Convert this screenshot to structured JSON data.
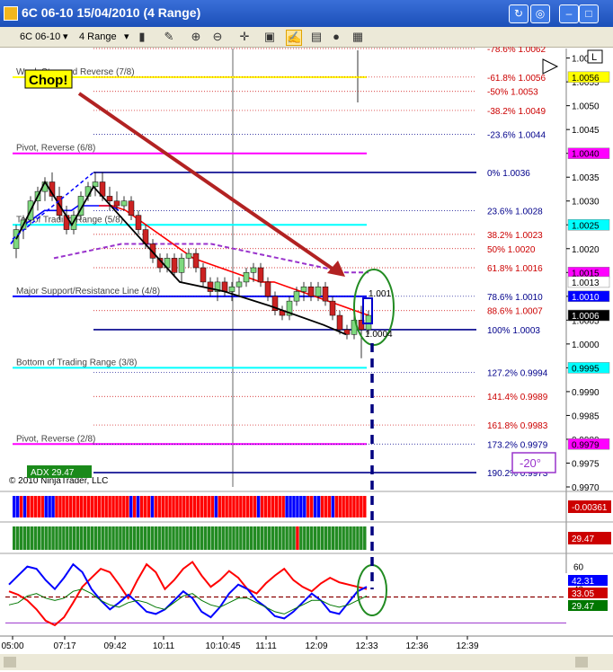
{
  "window": {
    "title": "6C 06-10  15/04/2010 (4 Range)"
  },
  "toolbar": {
    "instrument": "6C 06-10",
    "interval": "4 Range"
  },
  "annotations": {
    "chop": "Chop!",
    "angle": "-20°",
    "copyright": "© 2010 NinjaTrader, LLC",
    "adx": "ADX 29.47",
    "left_clip_1": "1.001",
    "left_clip_2": "1.0004"
  },
  "chart_data": [
    {
      "type": "candlestick",
      "title": "",
      "ylim": [
        0.997,
        1.0062
      ],
      "y_ticks": [
        1.006,
        1.0055,
        1.005,
        1.0045,
        1.004,
        1.0035,
        1.003,
        1.0025,
        1.002,
        1.0015,
        1.001,
        1.0005,
        1.0,
        0.9995,
        0.999,
        0.9985,
        0.998,
        0.9975,
        0.997
      ],
      "y_tick_labels": [
        "1.0060",
        "1.0055",
        "1.0050",
        "1.0045",
        "1.0040",
        "1.0035",
        "1.0030",
        "1.0025",
        "1.0020",
        "1.0015",
        "1.0010",
        "1.0005",
        "1.0000",
        "0.9995",
        "0.9990",
        "0.9985",
        "0.9980",
        "0.9975",
        "0.9970"
      ],
      "price_markers": [
        {
          "value": 1.0056,
          "label": "1.0056",
          "color": "#ffff00"
        },
        {
          "value": 1.004,
          "label": "1.0040",
          "color": "#ff00ff"
        },
        {
          "value": 1.0025,
          "label": "1.0025",
          "color": "#00ffff"
        },
        {
          "value": 1.0015,
          "label": "1.0015",
          "color": "#ff00ff"
        },
        {
          "value": 1.0013,
          "label": "1.0013",
          "color": "#ffffff"
        },
        {
          "value": 1.001,
          "label": "1.0010",
          "color": "#0000ff"
        },
        {
          "value": 1.0006,
          "label": "1.0006",
          "color": "#000000"
        },
        {
          "value": 0.9995,
          "label": "0.9995",
          "color": "#00ffff"
        },
        {
          "value": 0.9979,
          "label": "0.9979",
          "color": "#ff00ff"
        }
      ],
      "murrey_lines": [
        {
          "label": "Weak Stop and Reverse (7/8)",
          "value": 1.0056,
          "color": "#ffff00"
        },
        {
          "label": "Pivot, Reverse (6/8)",
          "value": 1.004,
          "color": "#ff00ff"
        },
        {
          "label": "Top of Trading Range (5/8)",
          "value": 1.0025,
          "color": "#00ffff"
        },
        {
          "label": "Major Support/Resistance Line (4/8)",
          "value": 1.001,
          "color": "#0000ff"
        },
        {
          "label": "Bottom of Trading Range (3/8)",
          "value": 0.9995,
          "color": "#00ffff"
        },
        {
          "label": "Pivot, Reverse (2/8)",
          "value": 0.9979,
          "color": "#ff00ff"
        }
      ],
      "fib_levels": [
        {
          "label": "-78.6%",
          "value": 1.0062
        },
        {
          "label": "-61.8%",
          "value": 1.0056
        },
        {
          "label": "-50%",
          "value": 1.0053
        },
        {
          "label": "-38.2%",
          "value": 1.0049
        },
        {
          "label": "-23.6%",
          "value": 1.0044
        },
        {
          "label": "0%",
          "value": 1.0036
        },
        {
          "label": "23.6%",
          "value": 1.0028
        },
        {
          "label": "38.2%",
          "value": 1.0023
        },
        {
          "label": "50%",
          "value": 1.002
        },
        {
          "label": "61.8%",
          "value": 1.0016
        },
        {
          "label": "78.6%",
          "value": 1.001
        },
        {
          "label": "88.6%",
          "value": 1.0007
        },
        {
          "label": "100%",
          "value": 1.0003
        },
        {
          "label": "127.2%",
          "value": 0.9994
        },
        {
          "label": "141.4%",
          "value": 0.9989
        },
        {
          "label": "161.8%",
          "value": 0.9983
        },
        {
          "label": "173.2%",
          "value": 0.9979
        },
        {
          "label": "190.2%",
          "value": 0.9973
        }
      ],
      "candles": [
        [
          1.002,
          1.0025,
          1.0018,
          1.0024
        ],
        [
          1.0024,
          1.0027,
          1.0022,
          1.0026
        ],
        [
          1.0026,
          1.0031,
          1.0025,
          1.003
        ],
        [
          1.003,
          1.0033,
          1.0028,
          1.0032
        ],
        [
          1.0032,
          1.0035,
          1.003,
          1.0034
        ],
        [
          1.0034,
          1.0036,
          1.003,
          1.0031
        ],
        [
          1.0031,
          1.0033,
          1.0026,
          1.0027
        ],
        [
          1.0027,
          1.0029,
          1.0023,
          1.0024
        ],
        [
          1.0024,
          1.0028,
          1.0023,
          1.0027
        ],
        [
          1.0027,
          1.0032,
          1.0026,
          1.0031
        ],
        [
          1.0031,
          1.0034,
          1.003,
          1.0033
        ],
        [
          1.0033,
          1.0036,
          1.0031,
          1.0034
        ],
        [
          1.0034,
          1.0036,
          1.003,
          1.0031
        ],
        [
          1.0031,
          1.0033,
          1.0028,
          1.003
        ],
        [
          1.003,
          1.0032,
          1.0028,
          1.0029
        ],
        [
          1.0029,
          1.0031,
          1.0028,
          1.003
        ],
        [
          1.003,
          1.0031,
          1.0026,
          1.0027
        ],
        [
          1.0027,
          1.0028,
          1.0023,
          1.0024
        ],
        [
          1.0024,
          1.0025,
          1.002,
          1.0021
        ],
        [
          1.0021,
          1.0022,
          1.0017,
          1.0018
        ],
        [
          1.0018,
          1.0019,
          1.0015,
          1.0016
        ],
        [
          1.0016,
          1.0019,
          1.0015,
          1.0018
        ],
        [
          1.0018,
          1.0019,
          1.0014,
          1.0015
        ],
        [
          1.0015,
          1.0019,
          1.0013,
          1.0018
        ],
        [
          1.0018,
          1.002,
          1.0016,
          1.0019
        ],
        [
          1.0019,
          1.002,
          1.0015,
          1.0016
        ],
        [
          1.0016,
          1.0017,
          1.0012,
          1.0013
        ],
        [
          1.0013,
          1.0014,
          1.001,
          1.0011
        ],
        [
          1.0011,
          1.0014,
          1.0009,
          1.0013
        ],
        [
          1.0013,
          1.0014,
          1.001,
          1.0011
        ],
        [
          1.0011,
          1.0013,
          1.0009,
          1.0012
        ],
        [
          1.0012,
          1.0014,
          1.001,
          1.0013
        ],
        [
          1.0013,
          1.0016,
          1.0012,
          1.0015
        ],
        [
          1.0015,
          1.0017,
          1.0013,
          1.0016
        ],
        [
          1.0016,
          1.0017,
          1.0012,
          1.0013
        ],
        [
          1.0013,
          1.0014,
          1.0009,
          1.001
        ],
        [
          1.001,
          1.0011,
          1.0006,
          1.0007
        ],
        [
          1.0007,
          1.0008,
          1.0005,
          1.0006
        ],
        [
          1.0006,
          1.001,
          1.0005,
          1.0009
        ],
        [
          1.0009,
          1.0012,
          1.0008,
          1.0011
        ],
        [
          1.0011,
          1.0013,
          1.0009,
          1.0012
        ],
        [
          1.0012,
          1.0013,
          1.0009,
          1.001
        ],
        [
          1.001,
          1.0013,
          1.0009,
          1.0012
        ],
        [
          1.0012,
          1.0013,
          1.0008,
          1.0009
        ],
        [
          1.0009,
          1.001,
          1.0005,
          1.0006
        ],
        [
          1.0006,
          1.0007,
          1.0002,
          1.0003
        ],
        [
          1.0003,
          1.0004,
          1.0001,
          1.0002
        ],
        [
          1.0002,
          1.0006,
          1.0001,
          1.0005
        ],
        [
          1.0005,
          1.0008,
          0.9997,
          1.0003
        ],
        [
          1.0003,
          1.0007,
          1.0002,
          1.0006
        ]
      ],
      "moving_averages": [
        {
          "name": "",
          "color": "#0000ff",
          "values": [
            1.0021,
            1.0023,
            1.0025,
            1.0026,
            1.0027,
            1.0028,
            1.0028,
            1.0028,
            1.0028,
            1.0028,
            1.0029,
            1.0029,
            1.0029,
            1.0029,
            1.0029,
            1.0029,
            1.0028
          ]
        },
        {
          "name": "",
          "color": "#ff0000",
          "values": [
            1.0029,
            1.0029,
            1.0028,
            1.0026,
            1.0024,
            1.0022,
            1.002,
            1.0018,
            1.0017,
            1.0016,
            1.0015,
            1.0014,
            1.0013,
            1.0013,
            1.0012,
            1.0011,
            1.001,
            1.0009,
            1.0008,
            1.0007,
            1.0006
          ]
        },
        {
          "name": "",
          "color": "#9933cc",
          "values": [
            1.0018,
            1.0019,
            1.002,
            1.0021,
            1.0021,
            1.0021,
            1.0021,
            1.0021,
            1.002,
            1.0019,
            1.0018,
            1.0017,
            1.0016,
            1.0015,
            1.0015
          ]
        }
      ]
    },
    {
      "type": "bar",
      "title": "",
      "description_value": "-0.00361",
      "values": [
        1,
        1,
        -1,
        1,
        -1,
        -1,
        -1,
        -1,
        -1,
        1,
        1,
        1,
        -1,
        -1,
        -1,
        -1,
        -1,
        -1,
        -1,
        -1,
        -1,
        -1,
        -1,
        -1,
        -1,
        -1,
        -1,
        -1,
        -1,
        -1,
        -1,
        -1,
        -1,
        1,
        -1,
        1,
        -1,
        -1,
        -1,
        1,
        -1,
        -1,
        -1,
        -1,
        -1,
        -1,
        -1,
        -1,
        -1,
        -1,
        -1,
        -1,
        -1,
        -1,
        -1,
        -1,
        -1,
        1,
        -1,
        -1,
        -1,
        -1,
        -1,
        -1,
        -1,
        -1,
        -1,
        -1,
        -1,
        1,
        -1,
        -1,
        -1,
        -1,
        -1,
        -1,
        -1,
        1,
        1,
        1,
        1,
        1,
        1,
        -1,
        -1,
        1,
        1,
        -1,
        -1,
        -1,
        1,
        -1,
        -1,
        -1,
        -1,
        -1,
        -1,
        -1,
        -1,
        -1
      ]
    },
    {
      "type": "bar",
      "title": "",
      "description_value": "29.47",
      "values": [
        1,
        1,
        1,
        1,
        1,
        1,
        1,
        1,
        1,
        1,
        1,
        1,
        1,
        1,
        1,
        1,
        1,
        1,
        1,
        1,
        1,
        1,
        1,
        1,
        1,
        1,
        1,
        1,
        1,
        1,
        1,
        1,
        1,
        1,
        1,
        1,
        1,
        1,
        1,
        1,
        1,
        1,
        1,
        1,
        1,
        1,
        1,
        1,
        1,
        1,
        1,
        1,
        1,
        1,
        1,
        1,
        1,
        1,
        1,
        1,
        1,
        1,
        1,
        1,
        1,
        1,
        1,
        1,
        1,
        1,
        1,
        1,
        1,
        1,
        1,
        1,
        1,
        1,
        1,
        1,
        -1,
        1,
        1,
        1,
        1,
        1,
        1,
        1,
        1,
        1,
        1,
        1,
        1,
        1,
        1,
        1,
        1,
        1,
        1,
        1
      ]
    },
    {
      "type": "line",
      "title": "",
      "ylim": [
        0,
        70
      ],
      "y_ticks": [
        60,
        40
      ],
      "y_tick_labels": [
        "60",
        "40"
      ],
      "x_labels": [
        "05:00",
        "07:17",
        "09:42",
        "10:11",
        "10:10:45",
        "11:11",
        "12:09",
        "12:33",
        "12:36",
        "12:39"
      ],
      "reference_level": 33,
      "series": [
        {
          "name": "",
          "color": "#ff0000",
          "values": [
            38,
            35,
            30,
            22,
            12,
            8,
            15,
            28,
            42,
            50,
            58,
            55,
            44,
            32,
            48,
            62,
            55,
            40,
            48,
            58,
            64,
            52,
            42,
            48,
            56,
            50,
            40,
            36,
            45,
            52,
            58,
            48,
            42,
            38,
            45,
            50,
            46,
            44,
            42,
            40
          ]
        },
        {
          "name": "",
          "color": "#0000ff",
          "values": [
            44,
            52,
            60,
            58,
            48,
            40,
            50,
            62,
            55,
            40,
            30,
            22,
            28,
            35,
            28,
            20,
            18,
            22,
            30,
            38,
            32,
            20,
            15,
            24,
            36,
            44,
            40,
            30,
            24,
            16,
            14,
            20,
            28,
            36,
            30,
            20,
            18,
            28,
            38,
            42
          ]
        },
        {
          "name": "",
          "color": "#007700",
          "values": [
            26,
            28,
            34,
            36,
            32,
            30,
            32,
            38,
            40,
            36,
            30,
            26,
            24,
            28,
            30,
            28,
            24,
            22,
            28,
            34,
            36,
            30,
            26,
            24,
            28,
            32,
            32,
            28,
            24,
            20,
            18,
            22,
            26,
            30,
            30,
            26,
            24,
            26,
            30,
            34
          ]
        }
      ],
      "value_markers": [
        {
          "label": "42.31",
          "color": "#0000ff"
        },
        {
          "label": "33.05",
          "color": "#cc0000"
        },
        {
          "label": "29.47",
          "color": "#007700"
        }
      ]
    }
  ]
}
